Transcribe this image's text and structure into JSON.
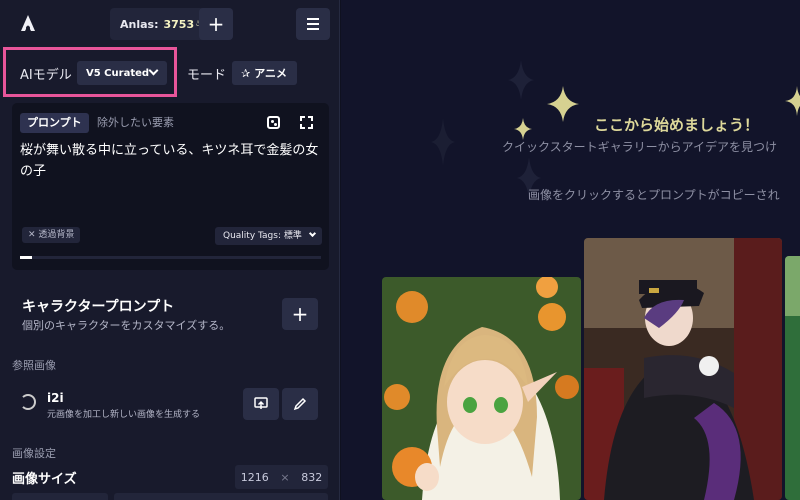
{
  "header": {
    "anlas_label": "Anlas:",
    "anlas_value": "3753",
    "anlas_icon": "anlas-coin-icon",
    "add_label": "+",
    "menu_icon": "hamburger-icon"
  },
  "model": {
    "label": "AIモデル",
    "selected": "V5 Curated",
    "highlight_color": "#e8559a"
  },
  "mode": {
    "label": "モード",
    "selected": "アニメ",
    "icon": "✰"
  },
  "prompt": {
    "tab_active": "プロンプト",
    "tab_inactive": "除外したい要素",
    "text": "桜が舞い散る中に立っている、キツネ耳で金髪の女の子",
    "transparent_bg": "✕ 透過背景",
    "quality_tags": "Quality Tags: 標準",
    "progress": 0.04
  },
  "character": {
    "title": "キャラクタープロンプト",
    "subtitle": "個別のキャラクターをカスタマイズする。",
    "add_label": "+"
  },
  "reference": {
    "section": "参照画像",
    "i2i_title": "i2i",
    "i2i_subtitle": "元画像を加工し新しい画像を生成する"
  },
  "image_settings": {
    "section": "画像設定",
    "size_title": "画像サイズ",
    "width": "1216",
    "times": "×",
    "height": "832"
  },
  "main": {
    "welcome": "ここから始めましょう！",
    "gallery_sub": "クイックスタートギャラリーからアイデアを見つけ",
    "click_hint": "画像をクリックするとプロンプトがコピーされ",
    "accent_color": "#ddd89a"
  }
}
